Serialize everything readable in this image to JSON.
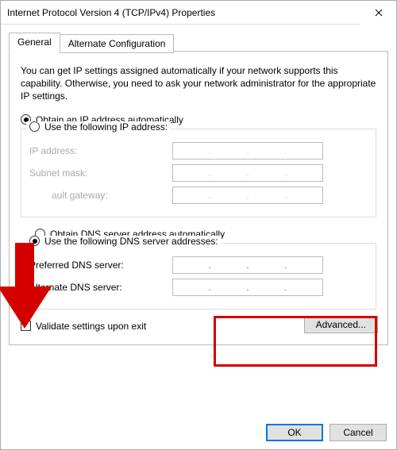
{
  "window": {
    "title": "Internet Protocol Version 4 (TCP/IPv4) Properties"
  },
  "tabs": {
    "general": "General",
    "alt": "Alternate Configuration"
  },
  "desc": "You can get IP settings assigned automatically if your network supports this capability. Otherwise, you need to ask your network administrator for the appropriate IP settings.",
  "ip": {
    "auto": "Obtain an IP address automatically",
    "manual": "Use the following IP address:",
    "addr_label": "IP address:",
    "mask_label": "Subnet mask:",
    "gw_label": "Default gateway:"
  },
  "dns": {
    "auto": "Obtain DNS server address automatically",
    "manual": "Use the following DNS server addresses:",
    "pref_label": "Preferred DNS server:",
    "alt_label": "Alternate DNS server:"
  },
  "validate": "Validate settings upon exit",
  "buttons": {
    "advanced": "Advanced...",
    "ok": "OK",
    "cancel": "Cancel"
  }
}
